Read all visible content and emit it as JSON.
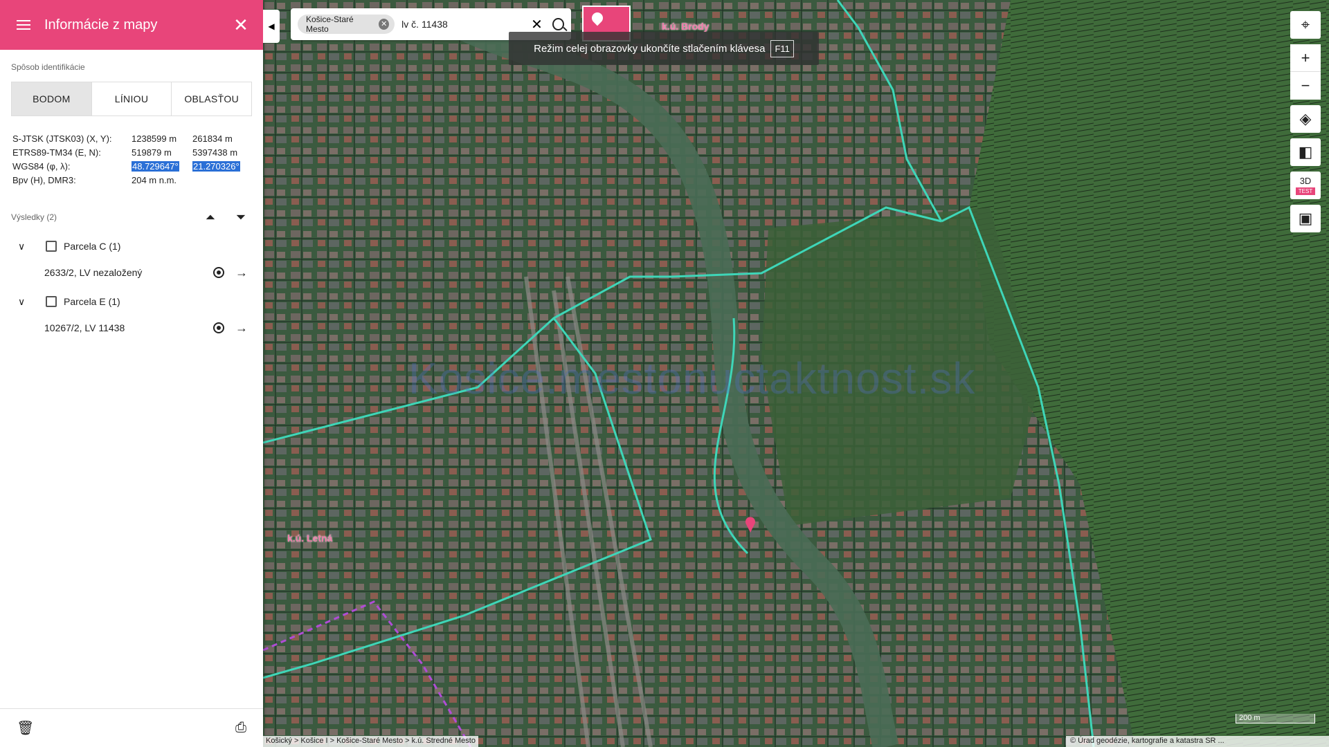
{
  "sidebar": {
    "title": "Informácie z mapy",
    "identification_label": "Spôsob identifikácie",
    "tabs": [
      {
        "label": "BODOM",
        "active": true
      },
      {
        "label": "LÍNIOU",
        "active": false
      },
      {
        "label": "OBLASŤOU",
        "active": false
      }
    ],
    "coords": [
      {
        "key": "S-JTSK (JTSK03) (X, Y):",
        "v1": "1238599 m",
        "v2": "261834 m"
      },
      {
        "key": "ETRS89-TM34 (E, N):",
        "v1": "519879 m",
        "v2": "5397438 m"
      },
      {
        "key": "WGS84 (φ, λ):",
        "v1": "48.729647°",
        "v2": "21.270326°"
      },
      {
        "key": "Bpv (H), DMR3:",
        "v1": "204 m n.m.",
        "v2": ""
      }
    ],
    "results_label": "Výsledky (2)",
    "groups": [
      {
        "label": "Parcela C (1)",
        "item": "2633/2, LV nezaložený"
      },
      {
        "label": "Parcela E (1)",
        "item": "10267/2, LV 11438"
      }
    ]
  },
  "search": {
    "chip": "Košice-Staré Mesto",
    "query": "lv č. 11438"
  },
  "fullscreen_msg": {
    "text": "Režim celej obrazovky ukončíte stlačením klávesa",
    "key": "F11"
  },
  "map": {
    "watermark": "Kosice.mestonuctaktnost.sk",
    "labels": {
      "brody": "k.ú. Brody",
      "letna": "k.ú. Letná"
    },
    "controls": {
      "three_d": "3D",
      "test_tag": "TEST"
    },
    "scale": "200 m",
    "breadcrumb": "Košický > Košice I > Košice-Staré Mesto > k.ú. Stredné Mesto",
    "attribution": "© Úrad geodézie, kartografie a katastra SR ..."
  },
  "colors": {
    "accent": "#e8457a",
    "boundary": "#3ed6b8"
  }
}
